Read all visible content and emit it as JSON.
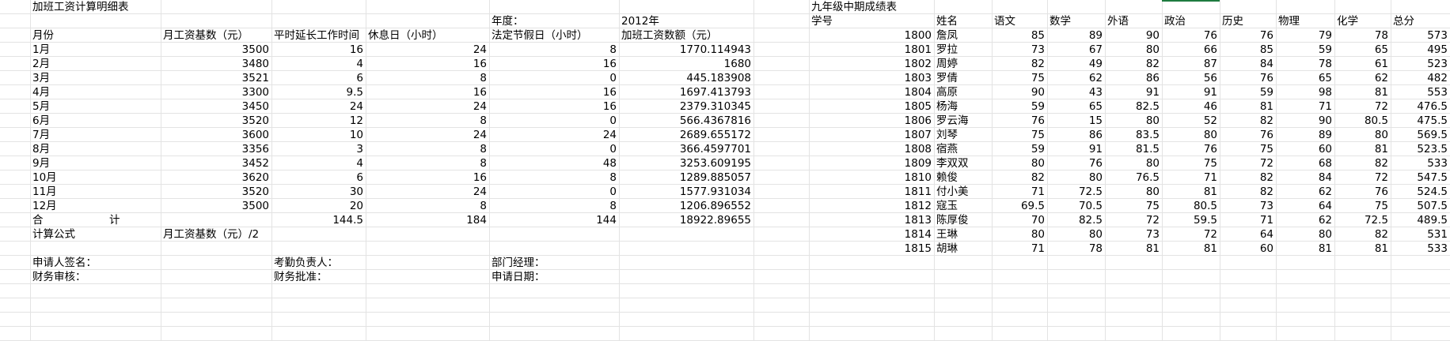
{
  "sheet": {
    "left": {
      "title": "加班工资计算明细表",
      "year_label": "年度：",
      "year_value": "2012年",
      "headers": [
        "月份",
        "月工资基数（元）",
        "平时延长工作时间",
        "休息日（小时）",
        "法定节假日（小时）",
        "加班工资数额（元）"
      ],
      "rows": [
        [
          "1月",
          "3500",
          "16",
          "24",
          "8",
          "1770.114943"
        ],
        [
          "2月",
          "3480",
          "4",
          "16",
          "16",
          "1680"
        ],
        [
          "3月",
          "3521",
          "6",
          "8",
          "0",
          "445.183908"
        ],
        [
          "4月",
          "3300",
          "9.5",
          "16",
          "16",
          "1697.413793"
        ],
        [
          "5月",
          "3450",
          "24",
          "24",
          "16",
          "2379.310345"
        ],
        [
          "6月",
          "3520",
          "12",
          "8",
          "0",
          "566.4367816"
        ],
        [
          "7月",
          "3600",
          "10",
          "24",
          "24",
          "2689.655172"
        ],
        [
          "8月",
          "3356",
          "3",
          "8",
          "0",
          "366.4597701"
        ],
        [
          "9月",
          "3452",
          "4",
          "8",
          "48",
          "3253.609195"
        ],
        [
          "10月",
          "3620",
          "6",
          "16",
          "8",
          "1289.885057"
        ],
        [
          "11月",
          "3520",
          "30",
          "24",
          "0",
          "1577.931034"
        ],
        [
          "12月",
          "3500",
          "20",
          "8",
          "8",
          "1206.896552"
        ]
      ],
      "total": {
        "label_a": "合",
        "label_b": "计",
        "c": "144.5",
        "d": "184",
        "e": "144",
        "f": "18922.89655"
      },
      "formula_label": "计算公式",
      "formula_text": "月工资基数（元）/2",
      "sign": {
        "applicant": "申请人签名：",
        "attendance": "考勤负责人：",
        "manager": "部门经理：",
        "finance_review": "财务审核：",
        "finance_approve": "财务批准：",
        "apply_date": "申请日期："
      }
    },
    "right": {
      "title": "九年级中期成绩表",
      "headers": [
        "学号",
        "姓名",
        "语文",
        "数学",
        "外语",
        "政治",
        "历史",
        "物理",
        "化学",
        "总分"
      ],
      "rows": [
        [
          "1800",
          "詹凤",
          "85",
          "89",
          "90",
          "76",
          "76",
          "79",
          "78",
          "573"
        ],
        [
          "1801",
          "罗拉",
          "73",
          "67",
          "80",
          "66",
          "85",
          "59",
          "65",
          "495"
        ],
        [
          "1802",
          "周婷",
          "82",
          "49",
          "82",
          "87",
          "84",
          "78",
          "61",
          "523"
        ],
        [
          "1803",
          "罗倩",
          "75",
          "62",
          "86",
          "56",
          "76",
          "65",
          "62",
          "482"
        ],
        [
          "1804",
          "高原",
          "90",
          "43",
          "91",
          "91",
          "59",
          "98",
          "81",
          "553"
        ],
        [
          "1805",
          "杨海",
          "59",
          "65",
          "82.5",
          "46",
          "81",
          "71",
          "72",
          "476.5"
        ],
        [
          "1806",
          "罗云海",
          "76",
          "15",
          "80",
          "52",
          "82",
          "90",
          "80.5",
          "475.5"
        ],
        [
          "1807",
          "刘琴",
          "75",
          "86",
          "83.5",
          "80",
          "76",
          "89",
          "80",
          "569.5"
        ],
        [
          "1808",
          "宿燕",
          "59",
          "91",
          "81.5",
          "76",
          "75",
          "60",
          "81",
          "523.5"
        ],
        [
          "1809",
          "李双双",
          "80",
          "76",
          "80",
          "75",
          "72",
          "68",
          "82",
          "533"
        ],
        [
          "1810",
          "赖俊",
          "82",
          "80",
          "76.5",
          "71",
          "82",
          "84",
          "72",
          "547.5"
        ],
        [
          "1811",
          "付小美",
          "71",
          "72.5",
          "80",
          "81",
          "82",
          "62",
          "76",
          "524.5"
        ],
        [
          "1812",
          "寇玉",
          "69.5",
          "70.5",
          "75",
          "80.5",
          "73",
          "64",
          "75",
          "507.5"
        ],
        [
          "1813",
          "陈厚俊",
          "70",
          "82.5",
          "72",
          "59.5",
          "71",
          "62",
          "72.5",
          "489.5"
        ],
        [
          "1814",
          "王琳",
          "80",
          "80",
          "73",
          "72",
          "64",
          "80",
          "82",
          "531"
        ],
        [
          "1815",
          "胡琳",
          "71",
          "78",
          "81",
          "81",
          "60",
          "81",
          "81",
          "533"
        ]
      ]
    },
    "accent": "#1e7b3f",
    "grid_color": "#e3e3e3"
  }
}
